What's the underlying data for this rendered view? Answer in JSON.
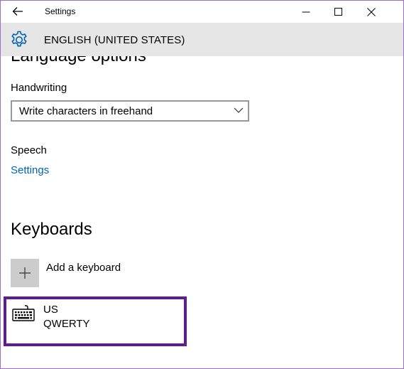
{
  "window": {
    "title": "Settings",
    "controls": {
      "back": "back-arrow-icon",
      "minimize": "minimize-icon",
      "maximize": "maximize-icon",
      "close": "close-icon"
    },
    "frame_color": "#9a6fc9"
  },
  "header": {
    "icon": "gear-icon",
    "title": "ENGLISH (UNITED STATES)",
    "background": "#e6e6e6",
    "icon_color": "#0063b1"
  },
  "language_options": {
    "heading": "Language options",
    "handwriting": {
      "label": "Handwriting",
      "selected_value": "Write characters in freehand"
    },
    "speech": {
      "label": "Speech",
      "link_text": "Settings",
      "link_color": "#0063b1"
    }
  },
  "keyboards": {
    "heading": "Keyboards",
    "add_label": "Add a keyboard",
    "add_icon": "plus-icon",
    "items": [
      {
        "icon": "keyboard-icon",
        "name": "US",
        "layout": "QWERTY"
      }
    ],
    "highlight_color": "#5f1a96"
  }
}
